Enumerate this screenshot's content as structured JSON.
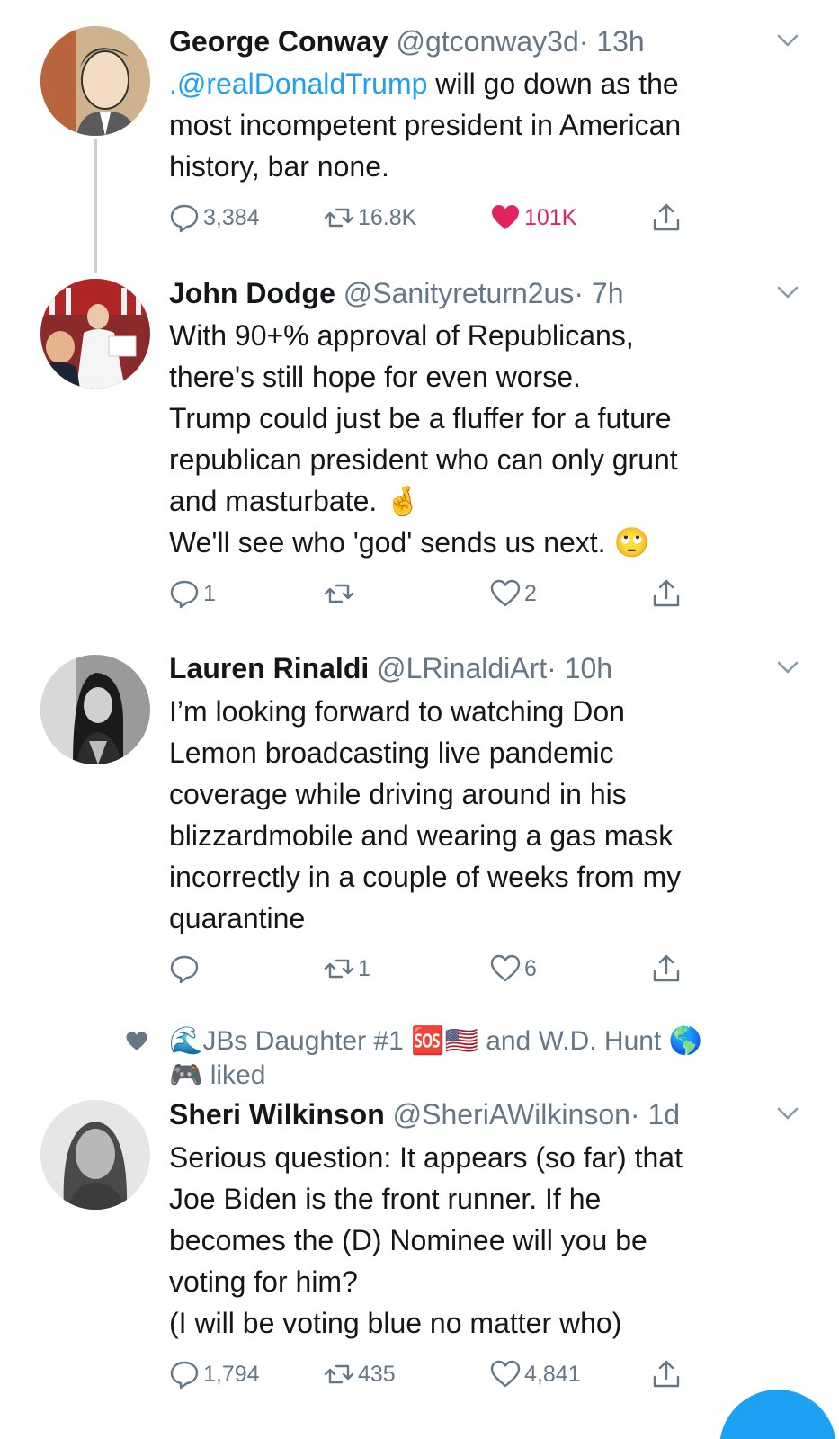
{
  "tweets": [
    {
      "name": "George Conway",
      "handle": "@gtconway3d",
      "time": "· 13h",
      "body": [
        {
          "mention": ".@realDonaldTrump",
          "text": " will go down as the"
        },
        {
          "text": "most incompetent president in American"
        },
        {
          "text": "history, bar none."
        }
      ],
      "replies": "3,384",
      "retweets": "16.8K",
      "likes": "101K",
      "liked": true
    },
    {
      "name": "John Dodge",
      "handle": "@Sanityreturn2us",
      "time": "· 7h",
      "body": [
        {
          "text": "With 90+% approval of Republicans,"
        },
        {
          "text": "there's still hope for even worse."
        },
        {
          "text": "Trump could just be a fluffer for a future"
        },
        {
          "text": "republican president who can only grunt"
        },
        {
          "text": "and masturbate. 🤞"
        },
        {
          "text": "We'll see who 'god' sends us next. 🙄"
        }
      ],
      "replies": "1",
      "retweets": "",
      "likes": "2",
      "liked": false
    },
    {
      "name": "Lauren Rinaldi",
      "handle": "@LRinaldiArt",
      "time": "· 10h",
      "body": [
        {
          "text": "I’m looking forward to watching Don"
        },
        {
          "text": "Lemon broadcasting live pandemic"
        },
        {
          "text": "coverage while driving around in his"
        },
        {
          "text": "blizzardmobile and wearing a gas mask"
        },
        {
          "text": "incorrectly in a couple of weeks from my"
        },
        {
          "text": "quarantine"
        }
      ],
      "replies": "",
      "retweets": "1",
      "likes": "6",
      "liked": false
    },
    {
      "social_context_line1": "🌊JBs Daughter #1 🆘🇺🇸 and W.D. Hunt 🌎",
      "social_context_line2": "🎮 liked",
      "name": "Sheri Wilkinson",
      "handle": "@SheriAWilkinson",
      "time": "· 1d",
      "body": [
        {
          "text": "Serious question: It appears (so far) that"
        },
        {
          "text": "Joe Biden is the front runner. If he"
        },
        {
          "text": "becomes the (D) Nominee will you be"
        },
        {
          "text": "voting for him?"
        },
        {
          "text": "(I will be voting blue no matter who)"
        }
      ],
      "replies": "1,794",
      "retweets": "435",
      "likes": "4,841",
      "liked": false
    }
  ],
  "icons": {
    "reply": "reply-icon",
    "retweet": "retweet-icon",
    "like": "heart-icon",
    "share": "share-icon",
    "more": "chevron-down-icon",
    "compose": "compose-fab"
  },
  "colors": {
    "link": "#1da1f2",
    "like": "#e0245e",
    "secondary": "#657786",
    "divider": "#e1e8ed"
  }
}
